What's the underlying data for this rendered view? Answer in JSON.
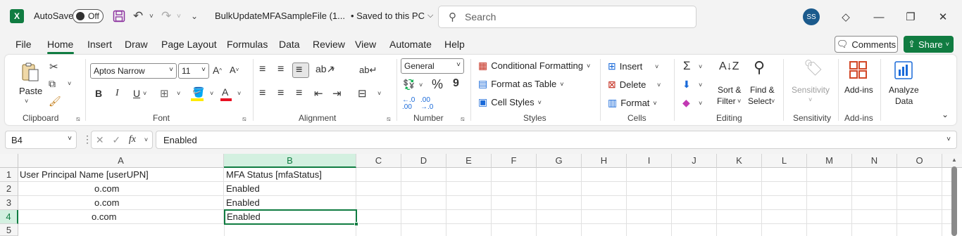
{
  "titlebar": {
    "app_logo": "X",
    "autosave_label": "AutoSave",
    "autosave_state": "Off",
    "filename": "BulkUpdateMFASampleFile (1...",
    "save_status": "• Saved to this PC",
    "search_placeholder": "Search",
    "avatar_initials": "SS"
  },
  "menu": {
    "tabs": [
      "File",
      "Home",
      "Insert",
      "Draw",
      "Page Layout",
      "Formulas",
      "Data",
      "Review",
      "View",
      "Automate",
      "Help"
    ],
    "active_tab": "Home",
    "comments_label": "Comments",
    "share_label": "Share"
  },
  "ribbon": {
    "clipboard": {
      "paste_label": "Paste",
      "group_label": "Clipboard"
    },
    "font": {
      "font_name": "Aptos Narrow",
      "font_size": "11",
      "group_label": "Font",
      "bold": "B",
      "italic": "I",
      "underline": "U",
      "grow": "A^",
      "shrink": "A˅",
      "font_color": "A"
    },
    "alignment": {
      "group_label": "Alignment"
    },
    "number": {
      "format": "General",
      "group_label": "Number",
      "percent": "%",
      "comma": "9",
      "inc_dec": "←.0\n.00",
      "dec_dec": ".00\n→.0"
    },
    "styles": {
      "conditional_formatting": "Conditional Formatting",
      "format_as_table": "Format as Table",
      "cell_styles": "Cell Styles",
      "group_label": "Styles"
    },
    "cells": {
      "insert": "Insert",
      "delete": "Delete",
      "format": "Format",
      "group_label": "Cells"
    },
    "editing": {
      "sum": "Σ",
      "sort_filter_1": "Sort &",
      "sort_filter_2": "Filter",
      "find_select_1": "Find &",
      "find_select_2": "Select",
      "group_label": "Editing"
    },
    "sensitivity": {
      "label": "Sensitivity",
      "group_label": "Sensitivity"
    },
    "addins": {
      "label": "Add-ins",
      "group_label": "Add-ins"
    },
    "analyze": {
      "label_1": "Analyze",
      "label_2": "Data"
    }
  },
  "formula_bar": {
    "name_box": "B4",
    "fx": "fx",
    "value": "Enabled"
  },
  "sheet": {
    "columns": [
      "A",
      "B",
      "C",
      "D",
      "E",
      "F",
      "G",
      "H",
      "I",
      "J",
      "K",
      "L",
      "M",
      "N",
      "O"
    ],
    "rows": [
      "1",
      "2",
      "3",
      "4",
      "5"
    ],
    "cells": {
      "A1": "User Principal Name [userUPN]",
      "B1": "MFA Status [mfaStatus]",
      "A2": "o.com",
      "B2": "Enabled",
      "A3": "o.com",
      "B3": "Enabled",
      "A4": "o.com",
      "B4": "Enabled"
    },
    "selected_cell": "B4"
  },
  "colors": {
    "accent": "#107c41",
    "selected_header": "#d3f0e0"
  }
}
